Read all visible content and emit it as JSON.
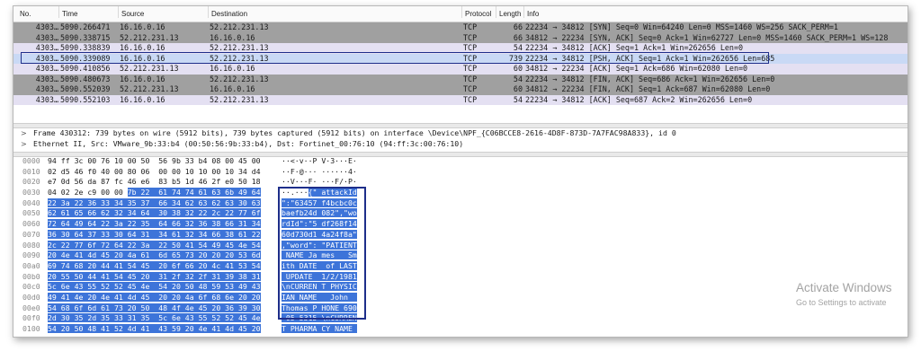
{
  "packet_list": {
    "columns": [
      "No.",
      "Time",
      "Source",
      "Destination",
      "Protocol",
      "Length",
      "Info"
    ],
    "rows": [
      {
        "no": "4303…",
        "time": "5090.266471",
        "src": "16.16.0.16",
        "dst": "52.212.231.13",
        "proto": "TCP",
        "len": "66",
        "info": "22234 → 34812 [SYN] Seq=0 Win=64240 Len=0 MSS=1460 WS=256 SACK_PERM=1",
        "bg": "#a0a0a0"
      },
      {
        "no": "4303…",
        "time": "5090.338715",
        "src": "52.212.231.13",
        "dst": "16.16.0.16",
        "proto": "TCP",
        "len": "66",
        "info": "34812 → 22234 [SYN, ACK] Seq=0 Ack=1 Win=62727 Len=0 MSS=1460 SACK_PERM=1 WS=128",
        "bg": "#a0a0a0"
      },
      {
        "no": "4303…",
        "time": "5090.338839",
        "src": "16.16.0.16",
        "dst": "52.212.231.13",
        "proto": "TCP",
        "len": "54",
        "info": "22234 → 34812 [ACK] Seq=1 Ack=1 Win=262656 Len=0",
        "bg": "#e4e0f2"
      },
      {
        "no": "4303…",
        "time": "5090.339089",
        "src": "16.16.0.16",
        "dst": "52.212.231.13",
        "proto": "TCP",
        "len": "739",
        "info": "22234 → 34812 [PSH, ACK] Seq=1 Ack=1 Win=262656 Len=685",
        "bg": "#c9d9f5"
      },
      {
        "no": "4303…",
        "time": "5090.410856",
        "src": "52.212.231.13",
        "dst": "16.16.0.16",
        "proto": "TCP",
        "len": "60",
        "info": "34812 → 22234 [ACK] Seq=1 Ack=686 Win=62080 Len=0",
        "bg": "#e4e0f2"
      },
      {
        "no": "4303…",
        "time": "5090.480673",
        "src": "16.16.0.16",
        "dst": "52.212.231.13",
        "proto": "TCP",
        "len": "54",
        "info": "22234 → 34812 [FIN, ACK] Seq=686 Ack=1 Win=262656 Len=0",
        "bg": "#a0a0a0"
      },
      {
        "no": "4303…",
        "time": "5090.552039",
        "src": "52.212.231.13",
        "dst": "16.16.0.16",
        "proto": "TCP",
        "len": "60",
        "info": "34812 → 22234 [FIN, ACK] Seq=1 Ack=687 Win=62080 Len=0",
        "bg": "#a0a0a0"
      },
      {
        "no": "4303…",
        "time": "5090.552103",
        "src": "16.16.0.16",
        "dst": "52.212.231.13",
        "proto": "TCP",
        "len": "54",
        "info": "22234 → 34812 [ACK] Seq=687 Ack=2 Win=262656 Len=0",
        "bg": "#e4e0f2"
      }
    ]
  },
  "details": [
    {
      "arrow": ">",
      "text": "Frame 430312: 739 bytes on wire (5912 bits), 739 bytes captured (5912 bits) on interface \\Device\\NPF_{C06BCCE8-2616-4D8F-873D-7A7FAC98A833}, id 0"
    },
    {
      "arrow": ">",
      "text": "Ethernet II, Src: VMware_9b:33:b4 (00:50:56:9b:33:b4), Dst: Fortinet_00:76:10 (94:ff:3c:00:76:10)"
    }
  ],
  "bytes": [
    {
      "off": "0000",
      "hex_a": "94 ff 3c 00 76 10 00 50  56 9b 33 b4 08 00 45 00",
      "hex_b": "",
      "asc_a": "··<·v··P V·3···E·",
      "asc_b": ""
    },
    {
      "off": "0010",
      "hex_a": "02 d5 46 f0 40 00 80 06  00 00 10 10 00 10 34 d4",
      "hex_b": "",
      "asc_a": "··F·@··· ······4·",
      "asc_b": ""
    },
    {
      "off": "0020",
      "hex_a": "e7 0d 56 da 87 fc 46 e6  83 b5 1d 46 2f e0 50 18",
      "hex_b": "",
      "asc_a": "··V···F· ···F/·P·",
      "asc_b": ""
    },
    {
      "off": "0030",
      "hex_a": "04 02 2e c9 00 00 ",
      "hex_b": "7b 22  61 74 74 61 63 6b 49 64",
      "asc_a": "··.···",
      "asc_b": "{\" attackId"
    },
    {
      "off": "0040",
      "hex_a": "",
      "hex_b": "22 3a 22 36 33 34 35 37  66 34 62 63 62 63 30 63",
      "asc_a": "",
      "asc_b": "\":\"63457 f4bcbc0c"
    },
    {
      "off": "0050",
      "hex_a": "",
      "hex_b": "62 61 65 66 62 32 34 64  30 38 32 22 2c 22 77 6f",
      "asc_a": "",
      "asc_b": "baefb24d 082\",\"wo"
    },
    {
      "off": "0060",
      "hex_a": "",
      "hex_b": "72 64 49 64 22 3a 22 35  64 66 32 36 38 66 31 34",
      "asc_a": "",
      "asc_b": "rdId\":\"5 df268f14"
    },
    {
      "off": "0070",
      "hex_a": "",
      "hex_b": "36 30 64 37 33 30 64 31  34 61 32 34 66 38 61 22",
      "asc_a": "",
      "asc_b": "60d730d1 4a24f8a\""
    },
    {
      "off": "0080",
      "hex_a": "",
      "hex_b": "2c 22 77 6f 72 64 22 3a  22 50 41 54 49 45 4e 54",
      "asc_a": "",
      "asc_b": ",\"word\": \"PATIENT"
    },
    {
      "off": "0090",
      "hex_a": "",
      "hex_b": "20 4e 41 4d 45 20 4a 61  6d 65 73 20 20 20 53 6d",
      "asc_a": "",
      "asc_b": " NAME Ja mes   Sm"
    },
    {
      "off": "00a0",
      "hex_a": "",
      "hex_b": "69 74 68 20 44 41 54 45  20 6f 66 20 4c 41 53 54",
      "asc_a": "",
      "asc_b": "ith DATE  of LAST"
    },
    {
      "off": "00b0",
      "hex_a": "",
      "hex_b": "20 55 50 44 41 54 45 20  31 2f 32 2f 31 39 38 31",
      "asc_a": "",
      "asc_b": " UPDATE  1/2/1981"
    },
    {
      "off": "00c0",
      "hex_a": "",
      "hex_b": "5c 6e 43 55 52 52 45 4e  54 20 50 48 59 53 49 43",
      "asc_a": "",
      "asc_b": "\\nCURREN T PHYSIC"
    },
    {
      "off": "00d0",
      "hex_a": "",
      "hex_b": "49 41 4e 20 4e 41 4d 45  20 20 4a 6f 68 6e 20 20",
      "asc_a": "",
      "asc_b": "IAN NAME   John  "
    },
    {
      "off": "00e0",
      "hex_a": "",
      "hex_b": "54 68 6f 6d 61 73 20 50  48 4f 4e 45 20 36 39 30",
      "asc_a": "",
      "asc_b": "Thomas P HONE 690"
    },
    {
      "off": "00f0",
      "hex_a": "",
      "hex_b": "2d 30 35 2d 35 33 31 35  5c 6e 43 55 52 52 45 4e",
      "asc_a": "",
      "asc_b": "-05-5315 \\nCURREN"
    },
    {
      "off": "0100",
      "hex_a": "",
      "hex_b": "54 20 50 48 41 52 4d 41  43 59 20 4e 41 4d 45 20",
      "asc_a": "",
      "asc_b": "T PHARMA CY NAME "
    }
  ],
  "watermark": {
    "title": "Activate Windows",
    "subtitle": "Go to Settings to activate"
  },
  "colors": {
    "selected_box": "#1e2e8a",
    "byte_highlight": "#3d74d9"
  }
}
